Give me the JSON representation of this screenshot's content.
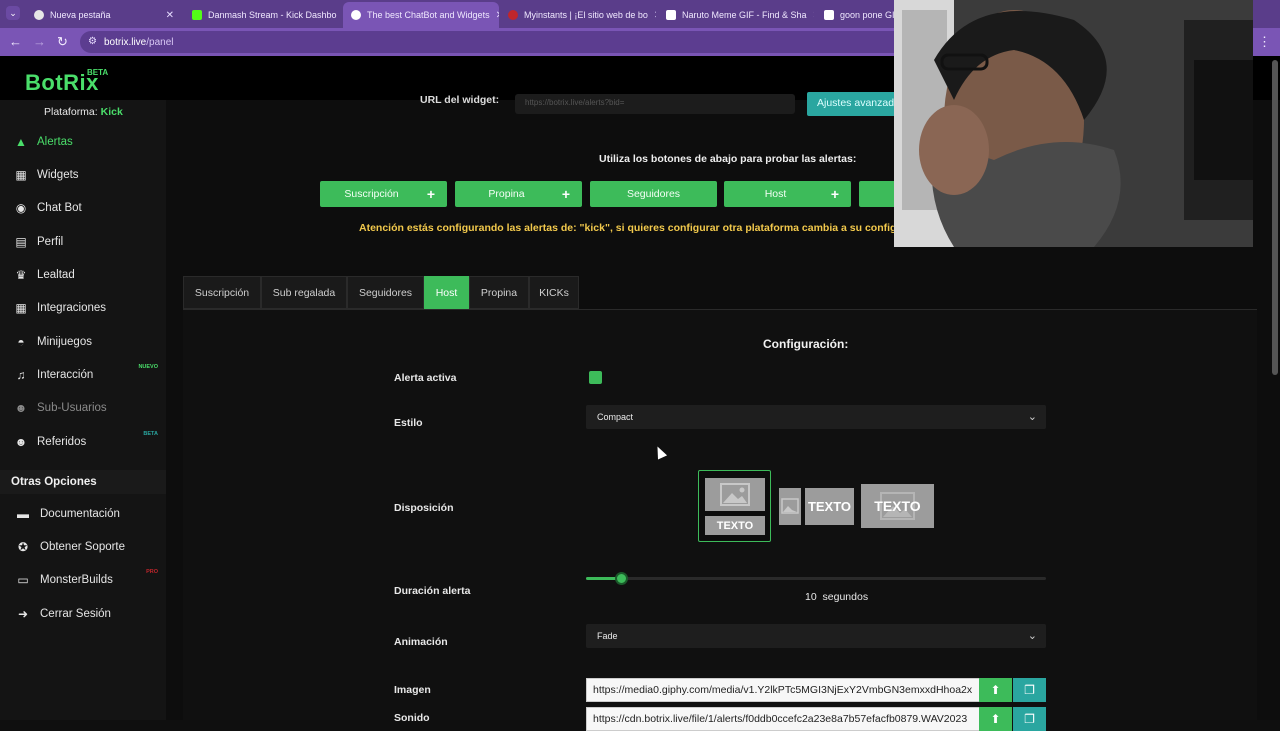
{
  "browser": {
    "tabs": [
      {
        "title": "Nueva pestaña",
        "active": false
      },
      {
        "title": "Danmash Stream - Kick Dashbo",
        "active": false
      },
      {
        "title": "The best ChatBot and Widgets",
        "active": true
      },
      {
        "title": "Myinstants | ¡El sitio web de bo",
        "active": false
      },
      {
        "title": "Naruto Meme GIF - Find & Sha",
        "active": false
      },
      {
        "title": "goon pone GIF",
        "active": false
      }
    ],
    "address": {
      "host": "botrix.live",
      "path": "/panel"
    }
  },
  "app": {
    "logo": "BotRix",
    "logo_badge": "BETA"
  },
  "sidebar": {
    "platform_label": "Plataforma:",
    "platform_value": "Kick",
    "items": [
      {
        "label": "Alertas",
        "icon": "warning-icon",
        "glyph": "▲"
      },
      {
        "label": "Widgets",
        "icon": "grid-icon",
        "glyph": "▦"
      },
      {
        "label": "Chat Bot",
        "icon": "robot-icon",
        "glyph": "◉"
      },
      {
        "label": "Perfil",
        "icon": "id-card-icon",
        "glyph": "▤"
      },
      {
        "label": "Lealtad",
        "icon": "trophy-icon",
        "glyph": "♛"
      },
      {
        "label": "Integraciones",
        "icon": "grid-icon",
        "glyph": "▦"
      },
      {
        "label": "Minijuegos",
        "icon": "gamepad-icon",
        "glyph": "◓"
      },
      {
        "label": "Interacción",
        "icon": "music-icon",
        "glyph": "♫",
        "badge": "NUEVO"
      },
      {
        "label": "Sub-Usuarios",
        "icon": "users-icon",
        "glyph": "☻"
      },
      {
        "label": "Referidos",
        "icon": "users-icon",
        "glyph": "☻",
        "badge": "BETA"
      }
    ],
    "section_title": "Otras Opciones",
    "other_items": [
      {
        "label": "Documentación",
        "icon": "book-icon",
        "glyph": "▬"
      },
      {
        "label": "Obtener Soporte",
        "icon": "lifebuoy-icon",
        "glyph": "✪"
      },
      {
        "label": "MonsterBuilds",
        "icon": "monitor-icon",
        "glyph": "▭",
        "badge": "PRO"
      },
      {
        "label": "Cerrar Sesión",
        "icon": "logout-icon",
        "glyph": "➜"
      }
    ]
  },
  "main": {
    "url_label": "URL del widget:",
    "url_value": "https://botrix.live/alerts?bid=",
    "ajustes_label": "Ajustes avanzados",
    "test_heading": "Utiliza los botones de abajo para probar las alertas:",
    "test_buttons": [
      {
        "label": "Suscripción",
        "plus": true
      },
      {
        "label": "Propina",
        "plus": true
      },
      {
        "label": "Seguidores",
        "plus": false
      },
      {
        "label": "Host",
        "plus": true
      }
    ],
    "notice": "Atención estás configurando las alertas de: \"kick\", si quieres configurar otra plataforma cambia a su config",
    "alert_tabs": [
      "Suscripción",
      "Sub regalada",
      "Seguidores",
      "Host",
      "Propina",
      "KICKs"
    ],
    "active_tab": "Host",
    "config": {
      "title": "Configuración:",
      "alerta_activa_label": "Alerta activa",
      "estilo_label": "Estilo",
      "estilo_value": "Compact",
      "disposicion_label": "Disposición",
      "layout_text": "TEXTO",
      "duracion_label": "Duración alerta",
      "duracion_value": 10,
      "duracion_unit": "segundos",
      "duracion_fraction": 0.075,
      "animacion_label": "Animación",
      "animacion_value": "Fade",
      "imagen_label": "Imagen",
      "imagen_value": "https://media0.giphy.com/media/v1.Y2lkPTc5MGI3NjExY2VmbGN3emxxdHhoa2x",
      "sonido_label": "Sonido",
      "sonido_value": "https://cdn.botrix.live/file/1/alerts/f0ddb0ccefc2a23e8a7b57efacfb0879.WAV2023"
    }
  },
  "colors": {
    "accent": "#3dbb5a",
    "teal": "#2aa6a0",
    "warning": "#f2c94c",
    "chrome": "#7a55b5"
  }
}
